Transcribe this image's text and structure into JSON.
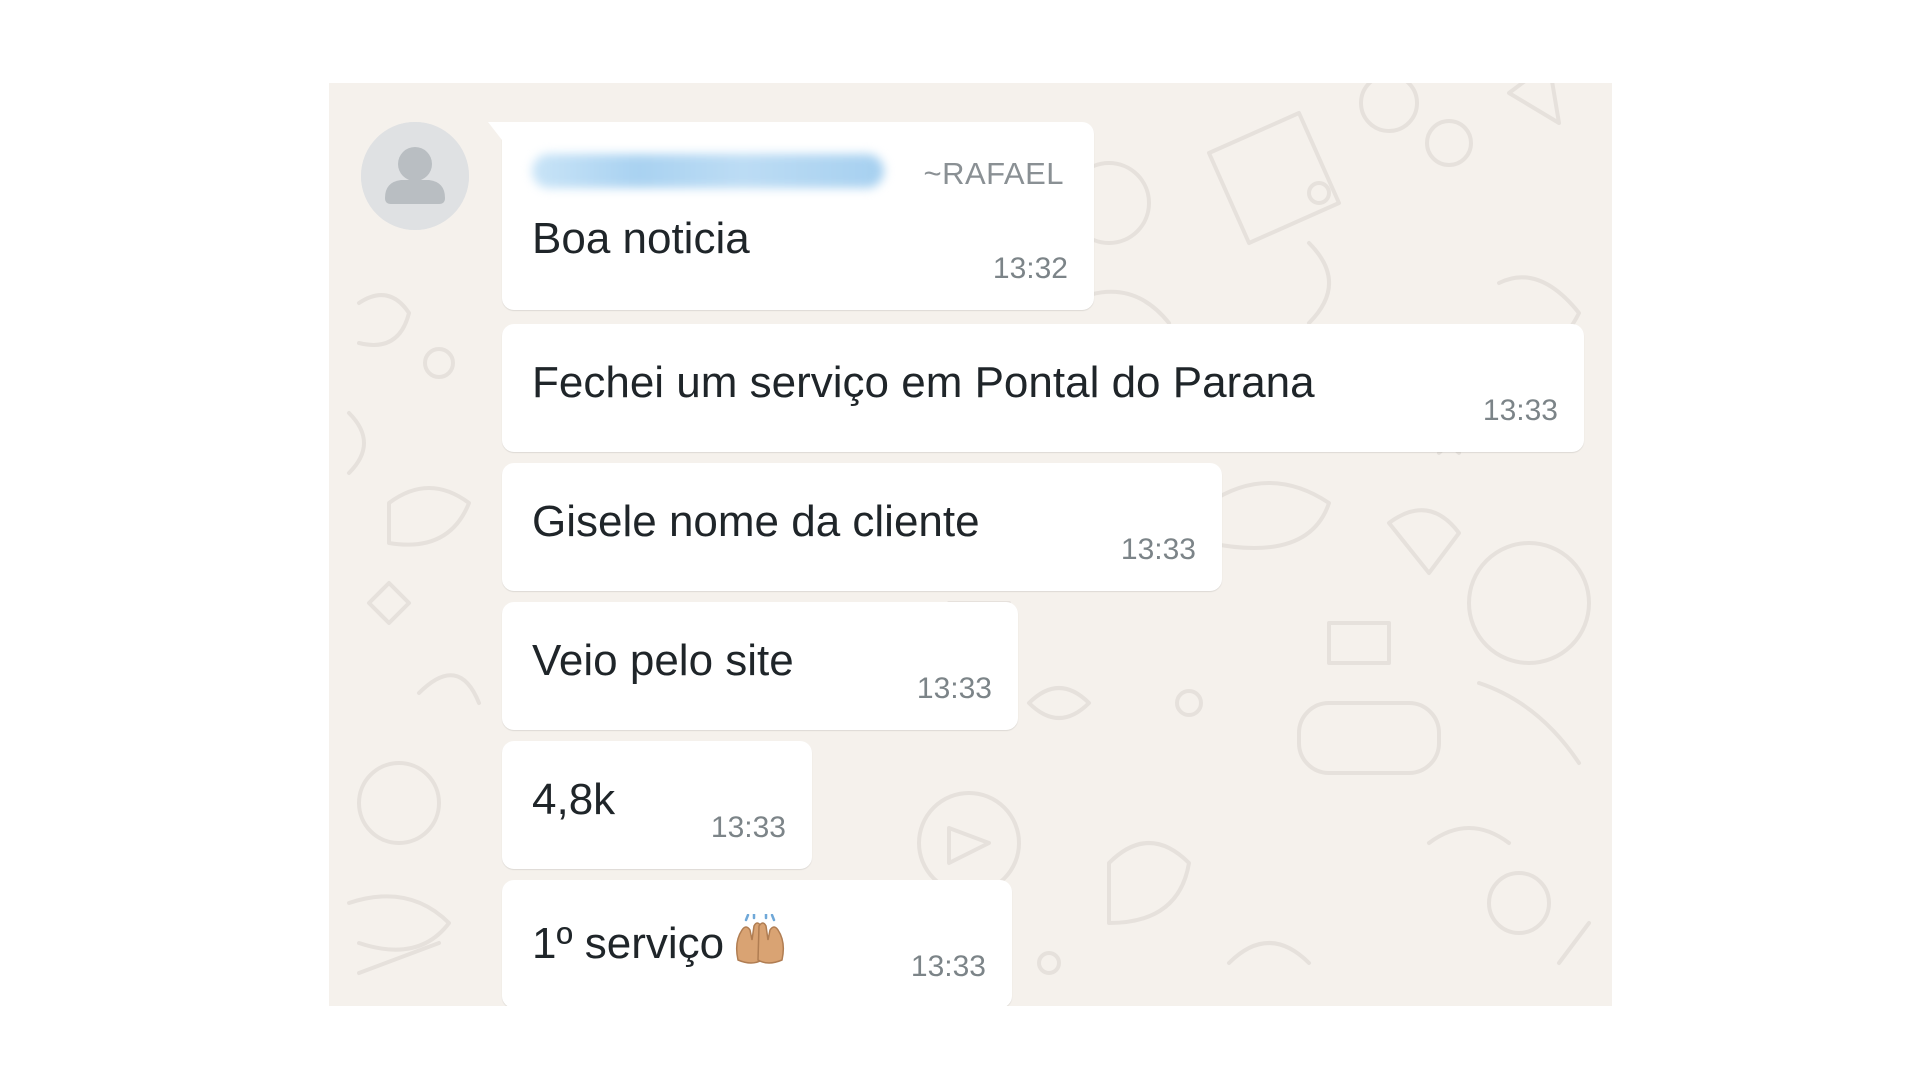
{
  "chat": {
    "background_color": "#f5f1ec",
    "bubble_color": "#ffffff",
    "sender": {
      "name": "~RAFAEL",
      "avatar_icon": "default-user-avatar-icon",
      "phone_obscured": true
    },
    "messages": [
      {
        "text": "Boa noticia",
        "time": "13:32"
      },
      {
        "text": "Fechei um serviço em Pontal do Parana",
        "time": "13:33"
      },
      {
        "text": "Gisele nome da cliente",
        "time": "13:33"
      },
      {
        "text": "Veio pelo site",
        "time": "13:33"
      },
      {
        "text": "4,8k",
        "time": "13:33"
      },
      {
        "text": "1º serviço",
        "emoji": "raising-hands-icon",
        "time": "13:33"
      }
    ]
  }
}
